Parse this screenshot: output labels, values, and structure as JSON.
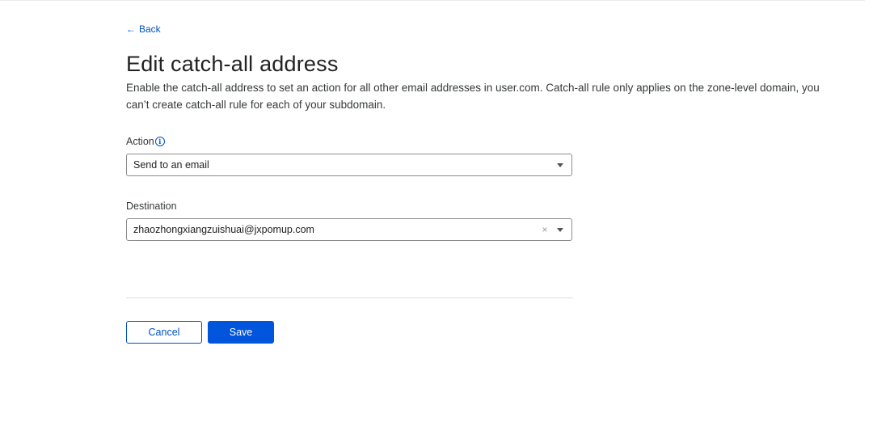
{
  "nav": {
    "back_arrow": "←",
    "back_label": "Back"
  },
  "page": {
    "title": "Edit catch-all address",
    "description": "Enable the catch-all address to set an action for all other email addresses in user.com. Catch-all rule only applies on the zone-level domain, you can’t create catch-all rule for each of your subdomain."
  },
  "form": {
    "action": {
      "label": "Action",
      "info_icon": "info-icon",
      "selected_value": "Send to an email"
    },
    "destination": {
      "label": "Destination",
      "selected_value": "zhaozhongxiangzuishuai@jxpomup.com",
      "clear_glyph": "×"
    }
  },
  "buttons": {
    "cancel_label": "Cancel",
    "save_label": "Save"
  },
  "colors": {
    "accent": "#0051c3",
    "primary_button": "#0055dc",
    "text": "#36393a",
    "border": "#8d8d8d"
  }
}
